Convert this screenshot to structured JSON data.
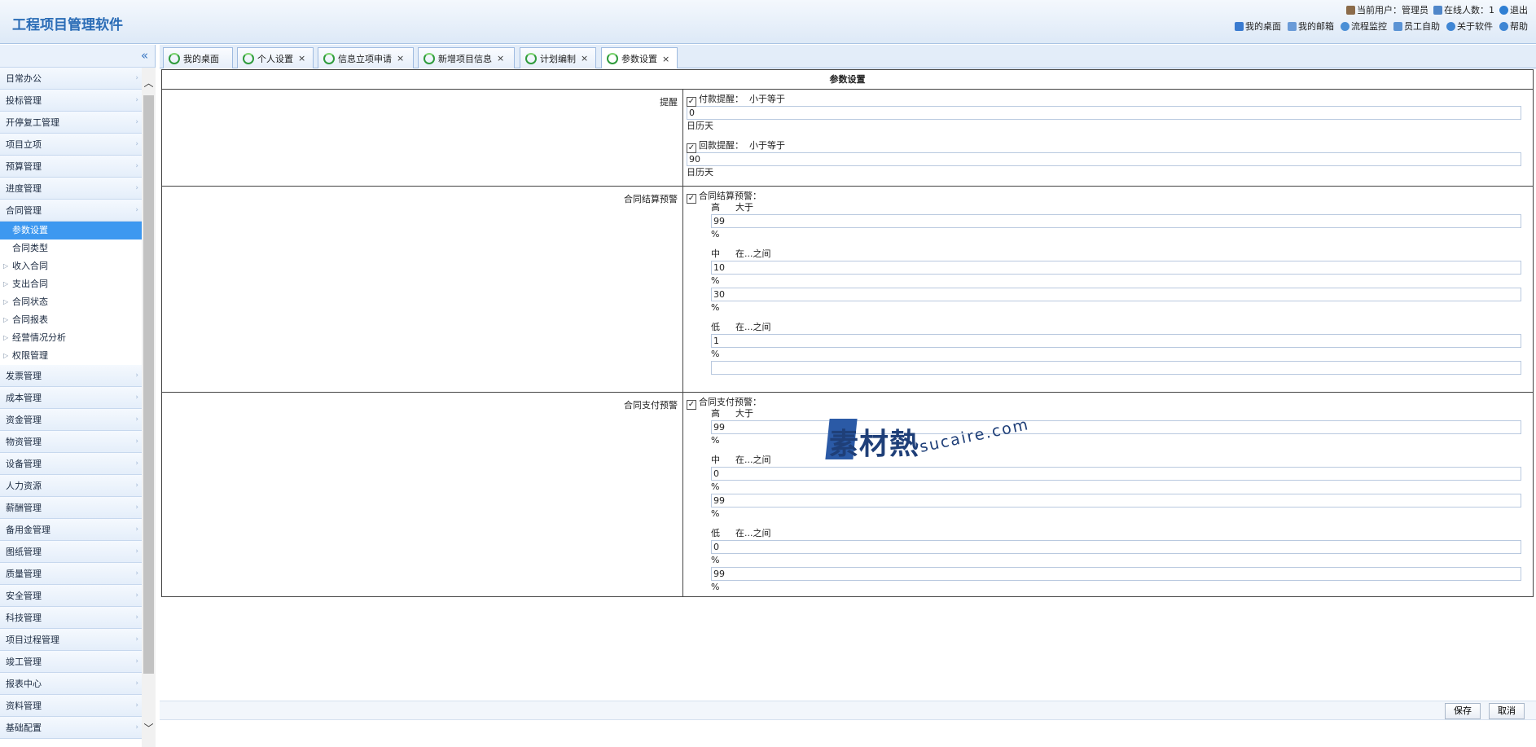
{
  "header": {
    "title": "工程项目管理软件",
    "current_user_label": "当前用户：",
    "current_user": "管理员",
    "online_label": "在线人数：",
    "online_count": "1",
    "logout": "退出",
    "nav": [
      "我的桌面",
      "我的邮箱",
      "流程监控",
      "员工自助",
      "关于软件",
      "帮助"
    ]
  },
  "sidebar": {
    "items_top": [
      "日常办公",
      "投标管理",
      "开停复工管理",
      "项目立项",
      "预算管理",
      "进度管理",
      "合同管理"
    ],
    "contract_sub": [
      {
        "label": "参数设置",
        "expandable": false,
        "active": true
      },
      {
        "label": "合同类型",
        "expandable": false,
        "active": false
      },
      {
        "label": "收入合同",
        "expandable": true,
        "active": false
      },
      {
        "label": "支出合同",
        "expandable": true,
        "active": false
      },
      {
        "label": "合同状态",
        "expandable": true,
        "active": false
      },
      {
        "label": "合同报表",
        "expandable": true,
        "active": false
      },
      {
        "label": "经营情况分析",
        "expandable": true,
        "active": false
      },
      {
        "label": "权限管理",
        "expandable": true,
        "active": false
      }
    ],
    "items_bottom": [
      "发票管理",
      "成本管理",
      "资金管理",
      "物资管理",
      "设备管理",
      "人力资源",
      "薪酬管理",
      "备用金管理",
      "图纸管理",
      "质量管理",
      "安全管理",
      "科技管理",
      "项目过程管理",
      "竣工管理",
      "报表中心",
      "资料管理",
      "基础配置"
    ]
  },
  "tabs": [
    {
      "label": "我的桌面",
      "closable": false
    },
    {
      "label": "个人设置",
      "closable": true
    },
    {
      "label": "信息立项申请",
      "closable": true
    },
    {
      "label": "新增项目信息",
      "closable": true
    },
    {
      "label": "计划编制",
      "closable": true
    },
    {
      "label": "参数设置",
      "closable": true,
      "active": true
    }
  ],
  "settings": {
    "title": "参数设置",
    "reminder": {
      "label": "提醒",
      "payment_check": "付款提醒：",
      "payment_cond": "小于等于",
      "payment_value": "0",
      "unit": "日历天",
      "collection_check": "回款提醒：",
      "collection_cond": "小于等于",
      "collection_value": "90"
    },
    "settlement": {
      "label": "合同结算预警",
      "check": "合同结算预警：",
      "high": "高",
      "high_cond": "大于",
      "high_value": "99",
      "mid": "中",
      "mid_cond": "在...之间",
      "mid_from": "10",
      "mid_to": "30",
      "low": "低",
      "low_cond": "在...之间",
      "low_from": "1",
      "low_to": "",
      "pct": "%"
    },
    "payment": {
      "label": "合同支付预警",
      "check": "合同支付预警：",
      "high": "高",
      "high_cond": "大于",
      "high_value": "99",
      "mid": "中",
      "mid_cond": "在...之间",
      "mid_from": "0",
      "mid_to": "99",
      "low": "低",
      "low_cond": "在...之间",
      "low_from": "0",
      "low_to": "99",
      "pct": "%"
    }
  },
  "watermark": {
    "cn": "素材熱",
    "en": "sucaire.com"
  },
  "footer": {
    "save": "保存",
    "cancel": "取消"
  },
  "colors": {
    "accent": "#3d98f0",
    "title": "#2a6cb6",
    "header_bg": "#dde9f7"
  }
}
